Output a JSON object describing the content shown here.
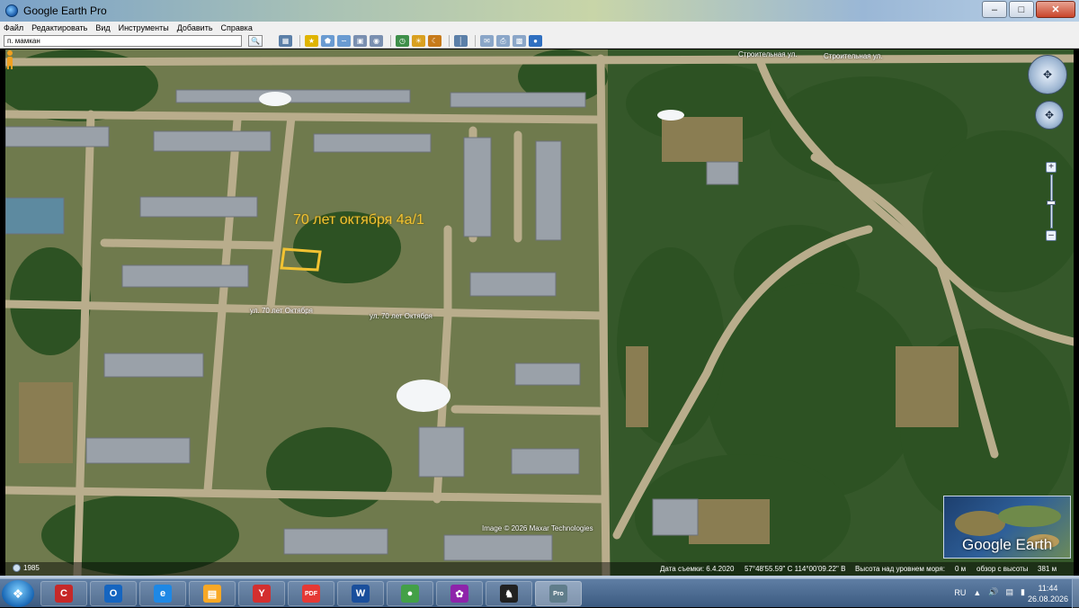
{
  "window": {
    "title": "Google Earth Pro",
    "controls": [
      "–",
      "□",
      "✕"
    ]
  },
  "menu": {
    "items": [
      "Файл",
      "Редактировать",
      "Вид",
      "Инструменты",
      "Добавить",
      "Справка"
    ]
  },
  "search": {
    "value": "п. мамкан",
    "button_icon": "search-icon"
  },
  "toolbar_icons": [
    "sidebar-icon",
    "placemark-icon",
    "polygon-icon",
    "path-icon",
    "image-overlay-icon",
    "tour-icon",
    "historical-imagery-icon",
    "sunlight-icon",
    "planet-icon",
    "ruler-icon",
    "email-icon",
    "print-icon",
    "save-image-icon",
    "maps-icon"
  ],
  "map": {
    "placemark_label": "70 лет октября 4а/1",
    "placemark_color": "#f1c232",
    "streets": [
      "Строительная ул.",
      "Строительная ул.",
      "ул. 70 лет Октября",
      "ул. 70 лет Октября"
    ],
    "image_credit": "Image © 2026 Maxar Technologies",
    "logo": "Google Earth"
  },
  "status": {
    "year": "1985",
    "date": "Дата съемки: 6.4.2020",
    "coords": "57°48'55.59\" С  114°00'09.22\" В",
    "elevation_label": "Высота над уровнем моря:",
    "elevation_value": "0 м",
    "eye_label": "обзор с высоты",
    "eye_value": "381 м"
  },
  "taskbar": {
    "apps": [
      "ccleaner-icon",
      "outlook-icon",
      "internet-explorer-icon",
      "file-explorer-icon",
      "yandex-browser-icon",
      "pdf-icon",
      "word-icon",
      "chrome-icon",
      "paint-icon",
      "batman-game-icon",
      "google-earth-pro-icon"
    ],
    "app_glyphs": [
      "C",
      "O",
      "e",
      "▤",
      "Y",
      "PDF",
      "W",
      "●",
      "✿",
      "♞",
      "Pro"
    ],
    "app_colors": [
      "#c62828",
      "#1565c0",
      "#1e88e5",
      "#f9a825",
      "#d32f2f",
      "#e53935",
      "#1a4f9c",
      "#43a047",
      "#8e24aa",
      "#212121",
      "#607d8b"
    ],
    "language": "RU",
    "time": "11:44",
    "date": "26.08.2026"
  }
}
